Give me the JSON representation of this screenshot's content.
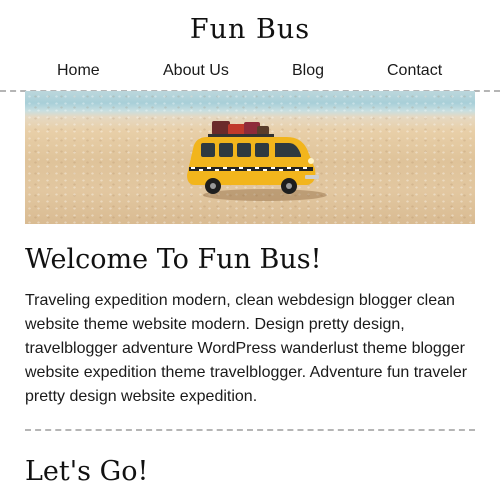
{
  "header": {
    "site_title": "Fun Bus"
  },
  "nav": {
    "items": [
      {
        "label": "Home"
      },
      {
        "label": "About Us"
      },
      {
        "label": "Blog"
      },
      {
        "label": "Contact"
      }
    ]
  },
  "hero": {
    "image_icon": "toy-bus-on-beach-image"
  },
  "main": {
    "welcome_heading": "Welcome To Fun Bus!",
    "welcome_text": "Traveling expedition modern, clean webdesign blogger clean website theme website modern. Design pretty design, travelblogger adventure WordPress wanderlust theme blogger website expedition theme travelblogger. Adventure fun traveler pretty design website expedition.",
    "lets_go_heading": "Let's Go!"
  },
  "colors": {
    "text": "#111111",
    "divider": "#b5b5b5",
    "background": "#ffffff",
    "bus": "#f2b51c"
  }
}
